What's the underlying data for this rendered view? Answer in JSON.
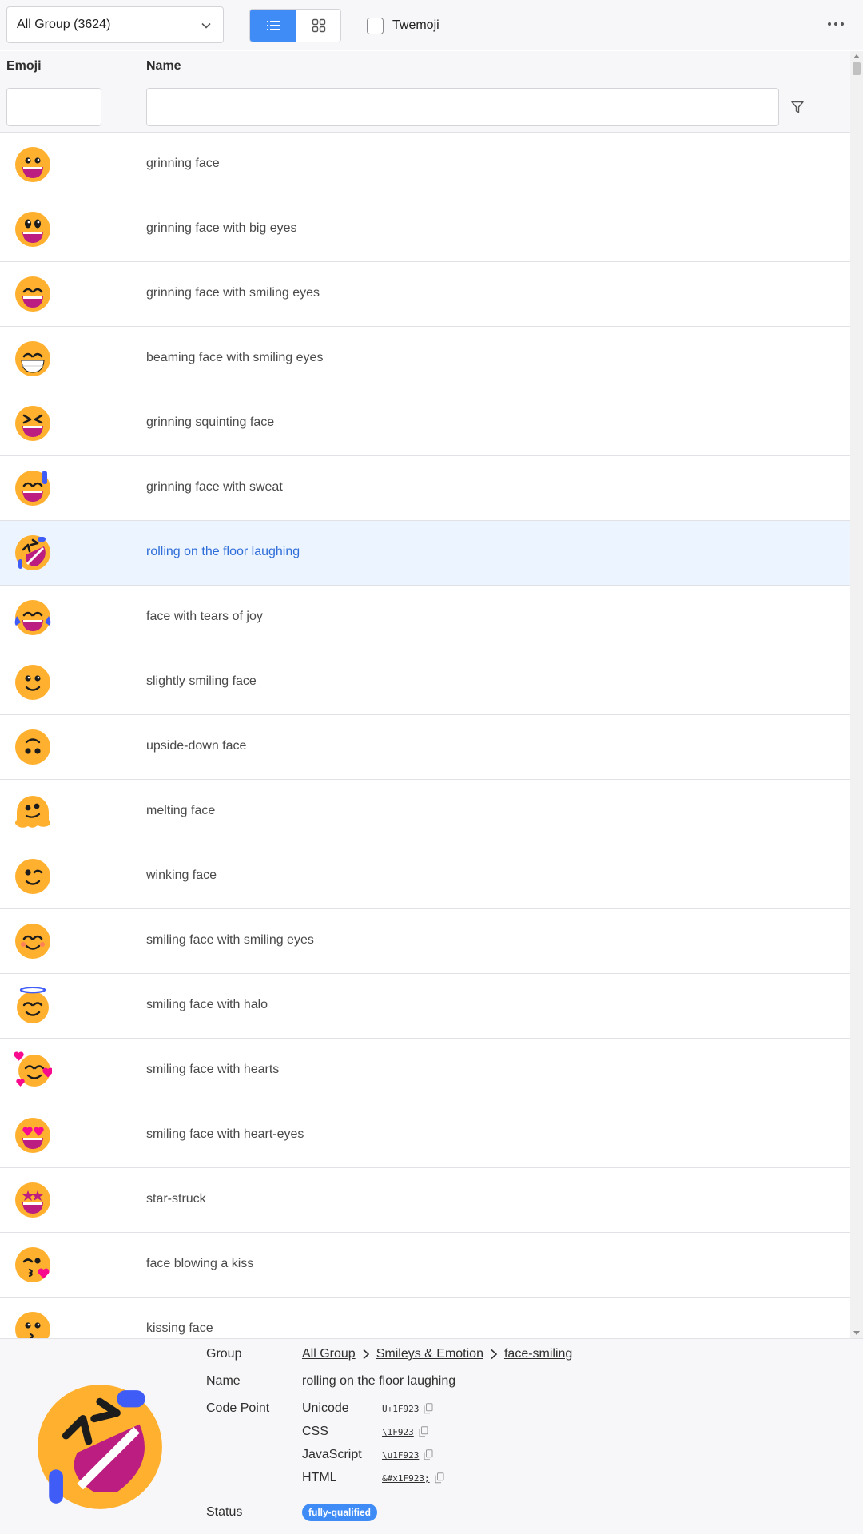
{
  "toolbar": {
    "group_select_value": "All Group (3624)",
    "twemoji_label": "Twemoji"
  },
  "table": {
    "columns": [
      "Emoji",
      "Name"
    ],
    "rows": [
      {
        "name": "grinning face",
        "icon": "grinning-face"
      },
      {
        "name": "grinning face with big eyes",
        "icon": "grinning-face-big-eyes"
      },
      {
        "name": "grinning face with smiling eyes",
        "icon": "grinning-face-smiling-eyes"
      },
      {
        "name": "beaming face with smiling eyes",
        "icon": "beaming-face"
      },
      {
        "name": "grinning squinting face",
        "icon": "grinning-squinting-face"
      },
      {
        "name": "grinning face with sweat",
        "icon": "grinning-face-sweat"
      },
      {
        "name": "rolling on the floor laughing",
        "icon": "rolling-on-floor-laughing",
        "selected": true
      },
      {
        "name": "face with tears of joy",
        "icon": "tears-of-joy"
      },
      {
        "name": "slightly smiling face",
        "icon": "slightly-smiling-face"
      },
      {
        "name": "upside-down face",
        "icon": "upside-down-face"
      },
      {
        "name": "melting face",
        "icon": "melting-face"
      },
      {
        "name": "winking face",
        "icon": "winking-face"
      },
      {
        "name": "smiling face with smiling eyes",
        "icon": "smiling-face-smiling-eyes"
      },
      {
        "name": "smiling face with halo",
        "icon": "smiling-face-halo"
      },
      {
        "name": "smiling face with hearts",
        "icon": "smiling-face-hearts"
      },
      {
        "name": "smiling face with heart-eyes",
        "icon": "heart-eyes"
      },
      {
        "name": "star-struck",
        "icon": "star-struck"
      },
      {
        "name": "face blowing a kiss",
        "icon": "face-blowing-kiss"
      },
      {
        "name": "kissing face",
        "icon": "kissing-face"
      }
    ]
  },
  "detail": {
    "labels": {
      "group": "Group",
      "name": "Name",
      "code_point": "Code Point",
      "status": "Status"
    },
    "breadcrumb": [
      "All Group",
      "Smileys & Emotion",
      "face-smiling"
    ],
    "name": "rolling on the floor laughing",
    "codes": [
      {
        "label": "Unicode",
        "value": "U+1F923"
      },
      {
        "label": "CSS",
        "value": "\\1F923"
      },
      {
        "label": "JavaScript",
        "value": "\\u1F923"
      },
      {
        "label": "HTML",
        "value": "&#x1F923;"
      }
    ],
    "status": "fully-qualified"
  },
  "colors": {
    "accent": "#3f8cf7",
    "selected_row_bg": "#ebf4ff",
    "selected_row_text": "#2f6dd8",
    "emoji_face": "#ffb02e",
    "emoji_mouth": "#bb1d80"
  }
}
